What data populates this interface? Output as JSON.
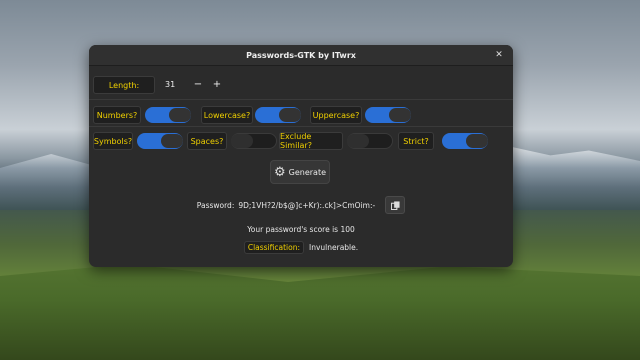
{
  "window": {
    "title": "Passwords-GTK by ITwrx"
  },
  "length": {
    "label": "Length:",
    "value": "31",
    "minus": "−",
    "plus": "+"
  },
  "options_row1": [
    {
      "label": "Numbers?",
      "on": true
    },
    {
      "label": "Lowercase?",
      "on": true
    },
    {
      "label": "Uppercase?",
      "on": true
    }
  ],
  "options_row2": [
    {
      "label": "Symbols?",
      "on": true
    },
    {
      "label": "Spaces?",
      "on": false
    },
    {
      "label": "Exclude Similar?",
      "on": false
    },
    {
      "label": "Strict?",
      "on": true
    }
  ],
  "generate": {
    "label": "Generate"
  },
  "password": {
    "label": "Password:",
    "value": "9D;1VH?2/b$@]c+Kr):.ck]>CmOim:-"
  },
  "score": {
    "text": "Your password's score is 100"
  },
  "classification": {
    "label": "Classification:",
    "value": "Invulnerable."
  },
  "colors": {
    "accent": "#2a6fd6",
    "label_text": "#f0d000",
    "window_bg": "#2b2b2b"
  }
}
